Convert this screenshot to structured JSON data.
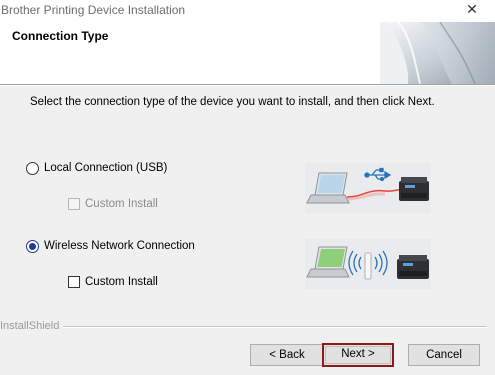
{
  "window": {
    "title": "Brother Printing Device Installation",
    "close_glyph": "✕"
  },
  "header": {
    "heading": "Connection Type"
  },
  "instruction": "Select the connection type of the device you want to install, and then click Next.",
  "options": [
    {
      "label": "Local Connection (USB)",
      "selected": false,
      "sub_option": {
        "label": "Custom Install",
        "checked": false,
        "enabled": false
      },
      "illustration": "laptop-usb-printer"
    },
    {
      "label": "Wireless Network Connection",
      "selected": true,
      "sub_option": {
        "label": "Custom Install",
        "checked": false,
        "enabled": true
      },
      "illustration": "laptop-wifi-printer"
    }
  ],
  "footer": {
    "brand": "InstallShield"
  },
  "buttons": {
    "back": "< Back",
    "next": "Next >",
    "cancel": "Cancel"
  },
  "colors": {
    "radio_selected": "#1f3a93",
    "next_highlight": "#8b1a1a"
  }
}
